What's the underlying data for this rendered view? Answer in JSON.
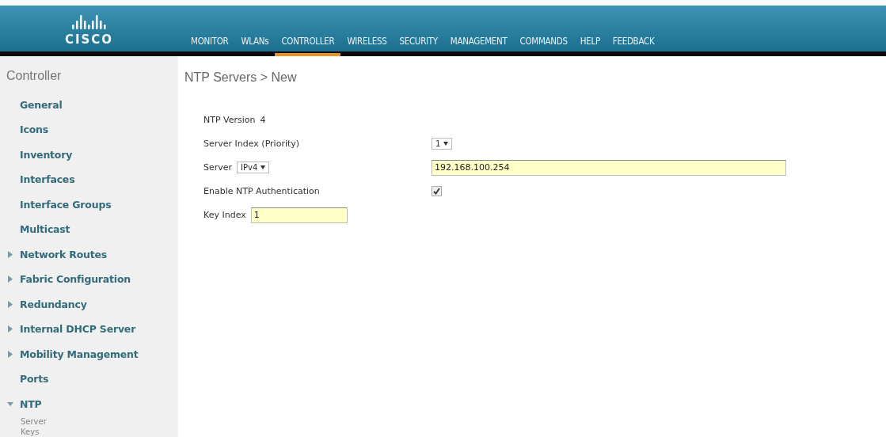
{
  "logo": {
    "text": "CISCO"
  },
  "nav": [
    {
      "label": "MONITOR",
      "selected": false
    },
    {
      "label": "WLANs",
      "selected": false
    },
    {
      "label": "CONTROLLER",
      "selected": true
    },
    {
      "label": "WIRELESS",
      "selected": false
    },
    {
      "label": "SECURITY",
      "selected": false
    },
    {
      "label": "MANAGEMENT",
      "selected": false
    },
    {
      "label": "COMMANDS",
      "selected": false
    },
    {
      "label": "HELP",
      "selected": false
    },
    {
      "label": "FEEDBACK",
      "selected": false
    }
  ],
  "sidebar": {
    "title": "Controller",
    "items": [
      {
        "label": "General",
        "kind": "plain"
      },
      {
        "label": "Icons",
        "kind": "plain"
      },
      {
        "label": "Inventory",
        "kind": "plain"
      },
      {
        "label": "Interfaces",
        "kind": "plain"
      },
      {
        "label": "Interface Groups",
        "kind": "plain"
      },
      {
        "label": "Multicast",
        "kind": "plain"
      },
      {
        "label": "Network Routes",
        "kind": "group",
        "expanded": false
      },
      {
        "label": "Fabric Configuration",
        "kind": "group",
        "expanded": false
      },
      {
        "label": "Redundancy",
        "kind": "group",
        "expanded": false
      },
      {
        "label": "Internal DHCP Server",
        "kind": "group",
        "expanded": false
      },
      {
        "label": "Mobility Management",
        "kind": "group",
        "expanded": false
      },
      {
        "label": "Ports",
        "kind": "plain"
      },
      {
        "label": "NTP",
        "kind": "group",
        "expanded": true,
        "children": [
          {
            "label": "Server"
          },
          {
            "label": "Keys"
          }
        ]
      }
    ]
  },
  "page_title": "NTP Servers > New",
  "form": {
    "ntp_version": {
      "label": "NTP Version",
      "value": "4"
    },
    "server_index": {
      "label": "Server Index (Priority)",
      "value": "1"
    },
    "server": {
      "label": "Server",
      "type": "IPv4",
      "value": "192.168.100.254"
    },
    "enable_auth": {
      "label": "Enable NTP Authentication",
      "checked": true
    },
    "key_index": {
      "label": "Key Index",
      "value": "1"
    }
  }
}
